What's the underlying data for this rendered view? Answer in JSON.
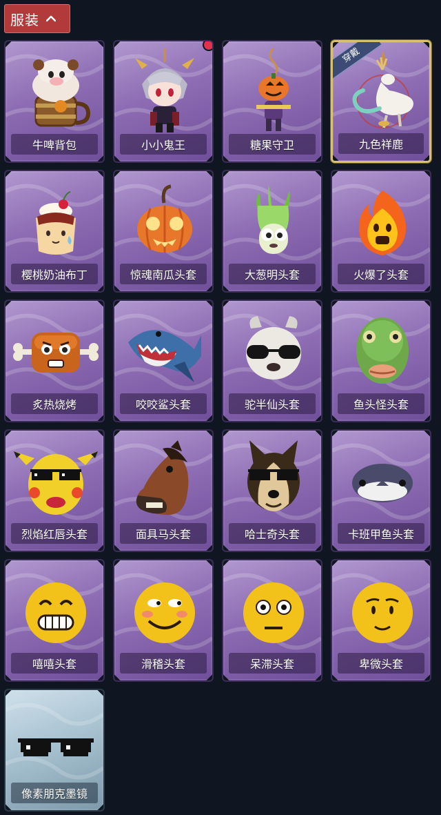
{
  "header": {
    "title": "服装"
  },
  "badges": {
    "equipped": "穿戴"
  },
  "items": [
    {
      "name": "牛啤背包",
      "icon": "cow-beer-backpack-icon",
      "style": "purple",
      "equipped": false,
      "new": false
    },
    {
      "name": "小小鬼王",
      "icon": "little-ghost-king-icon",
      "style": "purple",
      "equipped": false,
      "new": true
    },
    {
      "name": "糖果守卫",
      "icon": "candy-guard-icon",
      "style": "purple",
      "equipped": false,
      "new": false
    },
    {
      "name": "九色祥鹿",
      "icon": "nine-color-deer-icon",
      "style": "purple",
      "equipped": true,
      "new": false
    },
    {
      "name": "樱桃奶油布丁",
      "icon": "cherry-cream-pudding-icon",
      "style": "purple",
      "equipped": false,
      "new": false
    },
    {
      "name": "惊魂南瓜头套",
      "icon": "pumpkin-head-icon",
      "style": "purple",
      "equipped": false,
      "new": false
    },
    {
      "name": "大葱明头套",
      "icon": "scallion-head-icon",
      "style": "purple",
      "equipped": false,
      "new": false
    },
    {
      "name": "火爆了头套",
      "icon": "fire-head-icon",
      "style": "purple",
      "equipped": false,
      "new": false
    },
    {
      "name": "炙热烧烤",
      "icon": "bbq-meat-icon",
      "style": "purple",
      "equipped": false,
      "new": false
    },
    {
      "name": "咬咬鲨头套",
      "icon": "shark-head-icon",
      "style": "purple",
      "equipped": false,
      "new": false
    },
    {
      "name": "驼半仙头套",
      "icon": "alpaca-head-icon",
      "style": "purple",
      "equipped": false,
      "new": false
    },
    {
      "name": "鱼头怪头套",
      "icon": "fish-head-icon",
      "style": "purple",
      "equipped": false,
      "new": false
    },
    {
      "name": "烈焰红唇头套",
      "icon": "yellow-mouse-head-icon",
      "style": "purple",
      "equipped": false,
      "new": false
    },
    {
      "name": "面具马头套",
      "icon": "horse-head-icon",
      "style": "purple",
      "equipped": false,
      "new": false
    },
    {
      "name": "哈士奇头套",
      "icon": "husky-head-icon",
      "style": "purple",
      "equipped": false,
      "new": false
    },
    {
      "name": "卡班甲鱼头套",
      "icon": "pufferfish-head-icon",
      "style": "purple",
      "equipped": false,
      "new": false
    },
    {
      "name": "嘻嘻头套",
      "icon": "grin-emoji-icon",
      "style": "purple",
      "equipped": false,
      "new": false
    },
    {
      "name": "滑稽头套",
      "icon": "funny-emoji-icon",
      "style": "purple",
      "equipped": false,
      "new": false
    },
    {
      "name": "呆滞头套",
      "icon": "dazed-emoji-icon",
      "style": "purple",
      "equipped": false,
      "new": false
    },
    {
      "name": "卑微头套",
      "icon": "humble-emoji-icon",
      "style": "purple",
      "equipped": false,
      "new": false
    },
    {
      "name": "像素朋克墨镜",
      "icon": "pixel-sunglasses-icon",
      "style": "blue",
      "equipped": false,
      "new": false
    }
  ],
  "colors": {
    "background": "#0f1622",
    "tab": "#b33a3a",
    "card_purple": "#8d6cb3",
    "card_blue": "#a8c2d1",
    "equipped_border": "#d9c071",
    "new_dot": "#e0324c"
  }
}
